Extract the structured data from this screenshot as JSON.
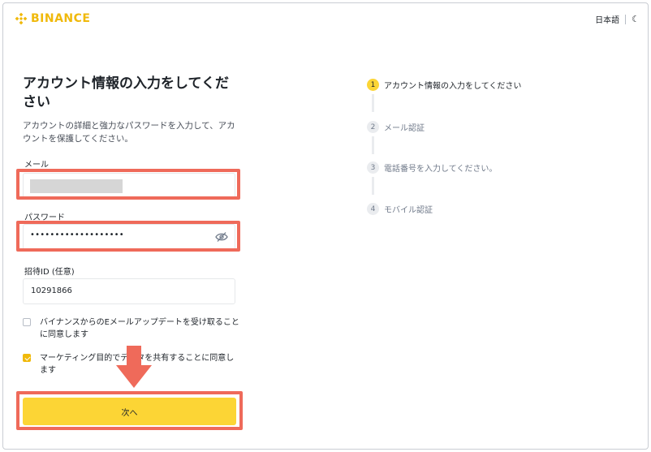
{
  "header": {
    "brand": "BINANCE",
    "language": "日本語",
    "theme_icon": "moon-icon"
  },
  "form": {
    "title": "アカウント情報の入力をしてください",
    "subtitle": "アカウントの詳細と強力なパスワードを入力して、アカウントを保護してください。",
    "email_label": "メール",
    "password_label": "パスワード",
    "password_value": "•••••••••••••••••••",
    "referral_label": "招待ID (任意)",
    "referral_value": "10291866",
    "checkbox_updates": {
      "label": "バイナンスからのEメールアップデートを受け取ることに同意します",
      "checked": false
    },
    "checkbox_marketing": {
      "label": "マーケティング目的でデータを共有することに同意します",
      "checked": true
    },
    "next_button": "次へ"
  },
  "steps": [
    {
      "num": "1",
      "label": "アカウント情報の入力をしてください",
      "active": true
    },
    {
      "num": "2",
      "label": "メール認証",
      "active": false
    },
    {
      "num": "3",
      "label": "電話番号を入力してください。",
      "active": false
    },
    {
      "num": "4",
      "label": "モバイル認証",
      "active": false
    }
  ],
  "colors": {
    "brand": "#f0b90b",
    "button": "#fcd535",
    "highlight": "#ef6a5a"
  }
}
